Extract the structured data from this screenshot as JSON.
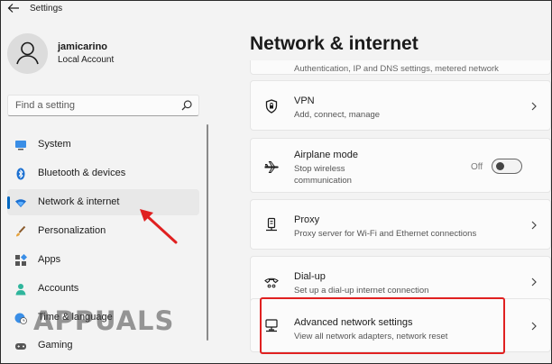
{
  "window": {
    "title": "Settings"
  },
  "user": {
    "name": "jamicarino",
    "account_type": "Local Account"
  },
  "search": {
    "placeholder": "Find a setting"
  },
  "sidebar": {
    "items": [
      {
        "label": "System",
        "icon": "monitor-icon"
      },
      {
        "label": "Bluetooth & devices",
        "icon": "bluetooth-icon"
      },
      {
        "label": "Network & internet",
        "icon": "wifi-icon",
        "active": true
      },
      {
        "label": "Personalization",
        "icon": "brush-icon"
      },
      {
        "label": "Apps",
        "icon": "apps-icon"
      },
      {
        "label": "Accounts",
        "icon": "person-icon"
      },
      {
        "label": "Time & language",
        "icon": "globe-clock-icon"
      },
      {
        "label": "Gaming",
        "icon": "gamepad-icon"
      }
    ]
  },
  "main": {
    "title": "Network & internet",
    "partial_card_sub": "Authentication, IP and DNS settings, metered network",
    "cards": [
      {
        "title": "VPN",
        "subtitle": "Add, connect, manage",
        "icon": "shield-icon"
      },
      {
        "title": "Airplane mode",
        "subtitle_line1": "Stop wireless",
        "subtitle_line2": "communication",
        "toggle_label": "Off",
        "toggle_on": false,
        "icon": "airplane-icon"
      },
      {
        "title": "Proxy",
        "subtitle": "Proxy server for Wi-Fi and Ethernet connections",
        "icon": "proxy-icon"
      },
      {
        "title": "Dial-up",
        "subtitle": "Set up a dial-up internet connection",
        "icon": "dialup-icon"
      },
      {
        "title": "Advanced network settings",
        "subtitle": "View all network adapters, network reset",
        "icon": "network-adapter-icon"
      }
    ]
  },
  "watermark": {
    "text": "APPUALS"
  },
  "colors": {
    "accent": "#0067c0",
    "highlight": "#e02020",
    "background": "#f3f3f3",
    "card": "#fbfbfb"
  }
}
